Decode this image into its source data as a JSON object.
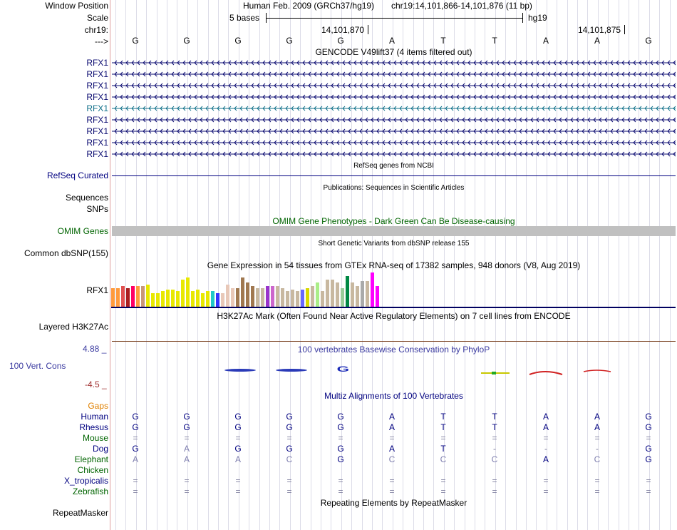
{
  "header": {
    "window_label": "Window Position",
    "scale_label": "Scale",
    "chr_label": "chr19:",
    "arrow_label": "--->",
    "assembly": "Human Feb. 2009 (GRCh37/hg19)",
    "position": "chr19:14,101,866-14,101,876 (11 bp)",
    "scale_text": "5 bases",
    "db": "hg19",
    "pos1": "14,101,870",
    "pos2": "14,101,875",
    "bases": [
      "G",
      "G",
      "G",
      "G",
      "G",
      "A",
      "T",
      "T",
      "A",
      "A",
      "G"
    ]
  },
  "gencode": {
    "title": "GENCODE V49lift37 (4 items filtered out)",
    "genes": [
      "RFX1",
      "RFX1",
      "RFX1",
      "RFX1",
      "RFX1",
      "RFX1",
      "RFX1",
      "RFX1",
      "RFX1"
    ]
  },
  "refseq": {
    "title": "RefSeq genes from NCBI",
    "label": "RefSeq Curated"
  },
  "publications": {
    "title": "Publications: Sequences in Scientific Articles",
    "label1": "Sequences",
    "label2": "SNPs"
  },
  "omim": {
    "title": "OMIM Gene Phenotypes - Dark Green Can Be Disease-causing",
    "label": "OMIM Genes"
  },
  "dbsnp": {
    "title": "Short Genetic Variants from dbSNP release 155",
    "label": "Common dbSNP(155)"
  },
  "gtex": {
    "title": "Gene Expression in 54 tissues from GTEx RNA-seq of 17382 samples, 948 donors (V8, Aug 2019)",
    "label": "RFX1",
    "levels": [
      0.55,
      0.55,
      0.6,
      0.55,
      0.6,
      0.6,
      0.6,
      0.65,
      0.4,
      0.4,
      0.45,
      0.5,
      0.5,
      0.45,
      0.8,
      0.85,
      0.45,
      0.5,
      0.4,
      0.45,
      0.45,
      0.4,
      0.4,
      0.65,
      0.55,
      0.55,
      0.85,
      0.7,
      0.6,
      0.55,
      0.55,
      0.6,
      0.6,
      0.6,
      0.55,
      0.45,
      0.5,
      0.45,
      0.5,
      0.55,
      0.6,
      0.7,
      0.45,
      0.8,
      0.8,
      0.7,
      0.55,
      0.9,
      0.7,
      0.6,
      0.75,
      0.75,
      1.0,
      0.6
    ],
    "colors": [
      "#ff9a3c",
      "#ff9a3c",
      "#e05050",
      "#aa2020",
      "#ff0066",
      "#ff9a3c",
      "#c89878",
      "#e8e800",
      "#e8e800",
      "#e8e800",
      "#e8e800",
      "#e8e800",
      "#e8e800",
      "#e8e800",
      "#e8e800",
      "#e8e800",
      "#e8e800",
      "#e8e800",
      "#e8e800",
      "#e8e800",
      "#20c8c8",
      "#3333ff",
      "#e8c8b8",
      "#e8c8b8",
      "#e8c8b8",
      "#a07850",
      "#a07850",
      "#a07850",
      "#a07850",
      "#c8b8a0",
      "#c8b8a0",
      "#9933cc",
      "#cc66cc",
      "#c8b8a0",
      "#c8b8a0",
      "#c8b8a0",
      "#c8b8a0",
      "#c8b8a0",
      "#6666ff",
      "#d8d800",
      "#c8b8a0",
      "#aaee88",
      "#c8b8a0",
      "#c8b8a0",
      "#c8b8a0",
      "#c8b8a0",
      "#99cc99",
      "#008844",
      "#c8b8a0",
      "#c8b8a0",
      "#aaaaaa",
      "#c8b8a0",
      "#ff00ff",
      "#ff00ff"
    ]
  },
  "h3k27ac": {
    "title": "H3K27Ac Mark (Often Found Near Active Regulatory Elements) on 7 cell lines from ENCODE",
    "label": "Layered H3K27Ac"
  },
  "conservation": {
    "title": "100 vertebrates Basewise Conservation by PhyloP",
    "label": "100 Vert. Cons",
    "max": "4.88 _",
    "min": "-4.5 _"
  },
  "multiz": {
    "title": "Multiz Alignments of 100 Vertebrates",
    "species": [
      {
        "name": "Gaps",
        "color": "#e08000",
        "seq": []
      },
      {
        "name": "Human",
        "color": "#000080",
        "seq": [
          "G",
          "G",
          "G",
          "G",
          "G",
          "A",
          "T",
          "T",
          "A",
          "A",
          "G"
        ]
      },
      {
        "name": "Rhesus",
        "color": "#000080",
        "seq": [
          "G",
          "G",
          "G",
          "G",
          "G",
          "A",
          "T",
          "T",
          "A",
          "A",
          "G"
        ]
      },
      {
        "name": "Mouse",
        "color": "#006400",
        "seq": [
          "=",
          "=",
          "=",
          "=",
          "=",
          "=",
          "=",
          "=",
          "=",
          "=",
          "="
        ]
      },
      {
        "name": "Dog",
        "color": "#000080",
        "seq": [
          "G",
          "A",
          "G",
          "G",
          "G",
          "A",
          "T",
          "-",
          "-",
          "-",
          "G"
        ]
      },
      {
        "name": "Elephant",
        "color": "#006400",
        "seq": [
          "A",
          "A",
          "A",
          "C",
          "G",
          "C",
          "C",
          "C",
          "A",
          "C",
          "G"
        ]
      },
      {
        "name": "Chicken",
        "color": "#006400",
        "seq": []
      },
      {
        "name": "X_tropicalis",
        "color": "#000080",
        "seq": [
          "=",
          "=",
          "=",
          "=",
          "=",
          "=",
          "=",
          "=",
          "=",
          "=",
          "="
        ]
      },
      {
        "name": "Zebrafish",
        "color": "#006400",
        "seq": [
          "=",
          "=",
          "=",
          "=",
          "=",
          "=",
          "=",
          "=",
          "=",
          "=",
          "="
        ]
      }
    ]
  },
  "repeatmasker": {
    "title": "Repeating Elements by RepeatMasker",
    "label": "RepeatMasker"
  }
}
